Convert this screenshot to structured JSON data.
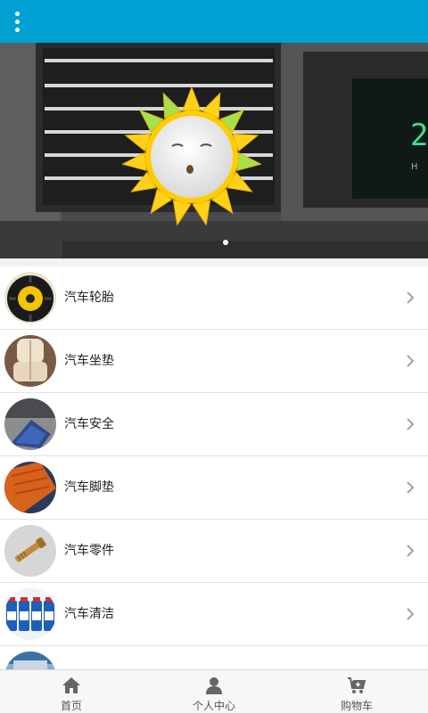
{
  "header": {
    "menu_icon": "more-vertical-icon",
    "bg_color": "#00a0d2"
  },
  "banner": {
    "slides": 1,
    "active_slide": 1
  },
  "categories": [
    {
      "label": "汽车轮胎",
      "icon": "tire-image"
    },
    {
      "label": "汽车坐垫",
      "icon": "seat-cushion-image"
    },
    {
      "label": "汽车安全",
      "icon": "safety-image"
    },
    {
      "label": "汽车脚垫",
      "icon": "floor-mat-image"
    },
    {
      "label": "汽车零件",
      "icon": "parts-image"
    },
    {
      "label": "汽车清洁",
      "icon": "cleaning-image"
    }
  ],
  "tabbar": {
    "home_label": "首页",
    "profile_label": "个人中心",
    "cart_label": "购物车"
  }
}
